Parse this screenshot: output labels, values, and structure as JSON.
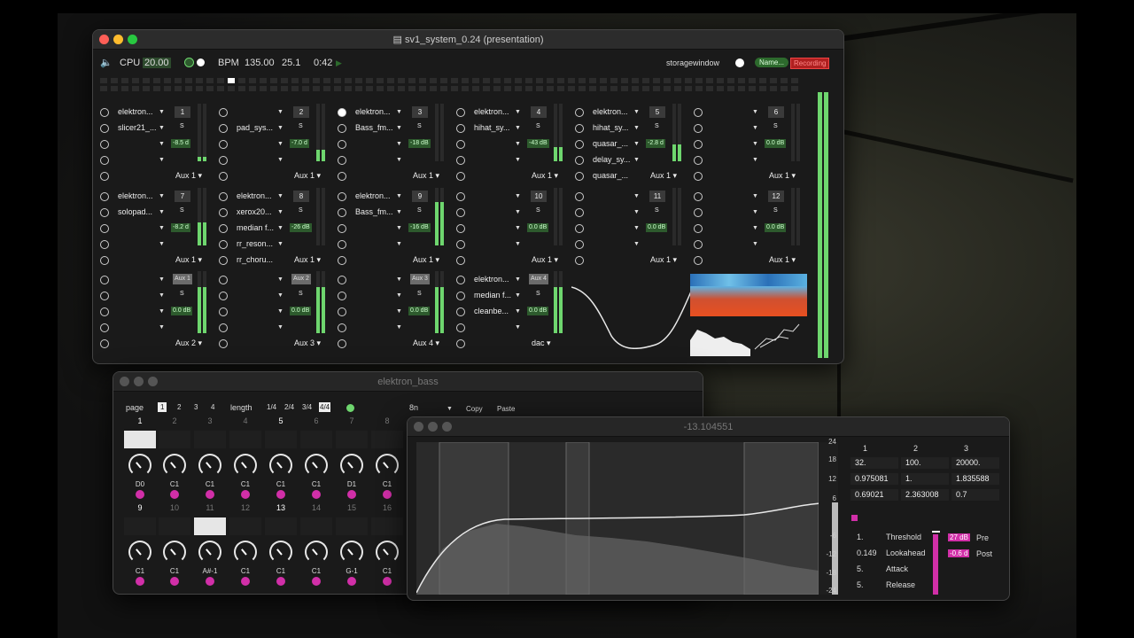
{
  "main_window": {
    "title": "sv1_system_0.24 (presentation)",
    "cpu_label": "CPU",
    "cpu_value": "20.00",
    "bpm_label": "BPM",
    "bpm_value": "135.00",
    "bar_value": "25.1",
    "time_value": "0:42",
    "storage_label": "storagewindow",
    "name_button": "Name...",
    "recording_button": "Recording"
  },
  "channels": [
    {
      "num": "1",
      "dev": "elektron...",
      "slot1": "slicer21_...",
      "gain": "-8.5 d",
      "slot3": "",
      "aux": "Aux 1",
      "level": 0.08
    },
    {
      "num": "2",
      "dev": "",
      "slot1": "pad_sys...",
      "gain": "-7.0 d",
      "slot3": "",
      "aux": "Aux 1",
      "level": 0.2
    },
    {
      "num": "3",
      "dev": "elektron...",
      "slot1": "Bass_fm...",
      "gain": "-18 dB",
      "slot3": "",
      "aux": "Aux 1",
      "level": 0
    },
    {
      "num": "4",
      "dev": "elektron...",
      "slot1": "hihat_sy...",
      "gain": "-43 dB",
      "slot3": "",
      "aux": "Aux 1",
      "level": 0.25
    },
    {
      "num": "5",
      "dev": "elektron...",
      "slot1": "hihat_sy...",
      "gain": "-2.8 d",
      "slot2": "quasar_...",
      "slot3": "delay_sy...",
      "slot4": "quasar_...",
      "aux": "Aux 1",
      "level": 0.3
    },
    {
      "num": "6",
      "dev": "",
      "slot1": "",
      "gain": "0.0 dB",
      "slot3": "",
      "aux": "Aux 1",
      "level": 0
    },
    {
      "num": "7",
      "dev": "elektron...",
      "slot1": "solopad...",
      "gain": "-8.2 d",
      "slot3": "",
      "aux": "Aux 1",
      "level": 0.4
    },
    {
      "num": "8",
      "dev": "elektron...",
      "slot1": "xerox20...",
      "gain": "-26 dB",
      "slot2": "median f...",
      "slot3": "rr_reson...",
      "slot4": "rr_choru...",
      "aux": "Aux 1",
      "level": 0
    },
    {
      "num": "9",
      "dev": "elektron...",
      "slot1": "Bass_fm...",
      "gain": "-16 dB",
      "slot3": "",
      "aux": "Aux 1",
      "level": 0.75
    },
    {
      "num": "10",
      "dev": "",
      "slot1": "",
      "gain": "0.0 dB",
      "slot3": "",
      "aux": "Aux 1",
      "level": 0
    },
    {
      "num": "11",
      "dev": "",
      "slot1": "",
      "gain": "0.0 dB",
      "slot3": "",
      "aux": "Aux 1",
      "level": 0
    },
    {
      "num": "12",
      "dev": "",
      "slot1": "",
      "gain": "0.0 dB",
      "slot3": "",
      "aux": "Aux 1",
      "level": 0
    }
  ],
  "aux_channels": [
    {
      "label": "Aux 1",
      "gain": "0.0 dB",
      "out": "Aux 2",
      "level": 0.75
    },
    {
      "label": "Aux 2",
      "gain": "0.0 dB",
      "out": "Aux 3",
      "level": 0.75
    },
    {
      "label": "Aux 3",
      "gain": "0.0 dB",
      "out": "Aux 4",
      "level": 0.75
    },
    {
      "label": "Aux 4",
      "dev": "elektron...",
      "slot1": "median f...",
      "slot2": "cleanbe...",
      "gain": "0.0 dB",
      "out": "dac",
      "level": 0.75
    }
  ],
  "seq_window": {
    "title": "elektron_bass",
    "page_label": "page",
    "pages": [
      "1",
      "2",
      "3",
      "4"
    ],
    "length_label": "length",
    "lengths": [
      "1/4",
      "2/4",
      "3/4",
      "4/4"
    ],
    "rate": "8n",
    "copy": "Copy",
    "paste": "Paste",
    "row1_nums": [
      "1",
      "2",
      "3",
      "4",
      "5",
      "6",
      "7",
      "8"
    ],
    "row1_notes": [
      "D0",
      "C1",
      "C1",
      "C1",
      "C1",
      "C1",
      "D1",
      "C1"
    ],
    "row2_nums": [
      "9",
      "10",
      "11",
      "12",
      "13",
      "14",
      "15",
      "16"
    ],
    "row2_notes": [
      "C1",
      "C1",
      "A#-1",
      "C1",
      "C1",
      "C1",
      "G-1",
      "C1"
    ]
  },
  "comp_window": {
    "title": "-13.104551",
    "col_headers": [
      "1",
      "2",
      "3"
    ],
    "rows": [
      [
        "32.",
        "100.",
        "20000."
      ],
      [
        "0.975081",
        "1.",
        "1.835588"
      ],
      [
        "0.69021",
        "2.363008",
        "0.7"
      ]
    ],
    "y_ticks": [
      "24",
      "18",
      "12",
      "6",
      "-6",
      "-12",
      "-18",
      "-24"
    ],
    "params": [
      {
        "value": "1.",
        "label": "Threshold"
      },
      {
        "value": "0.149",
        "label": "Lookahead"
      },
      {
        "value": "5.",
        "label": "Attack"
      },
      {
        "value": "5.",
        "label": "Release"
      }
    ],
    "pre_value": "27 dB",
    "pre_label": "Pre",
    "post_value": "-0.6 d",
    "post_label": "Post"
  }
}
